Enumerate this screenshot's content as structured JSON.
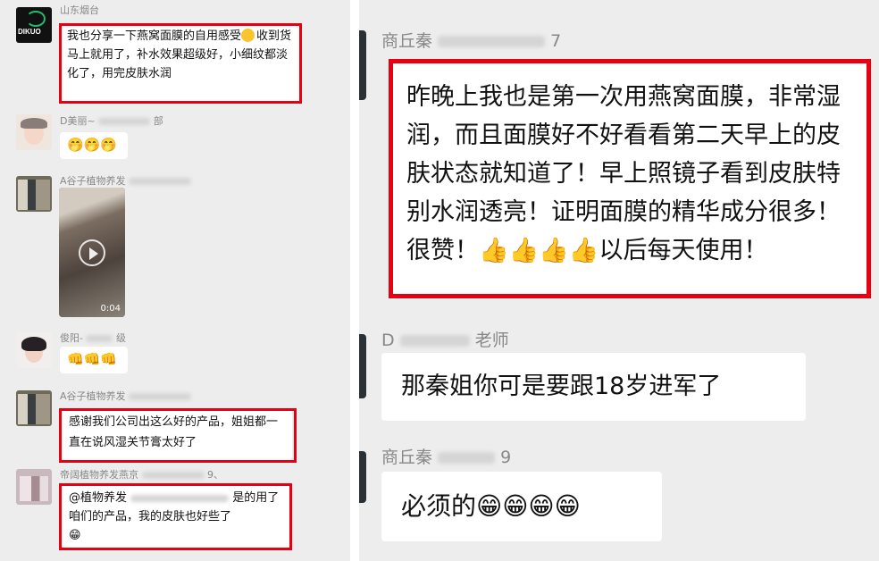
{
  "left_chat": {
    "messages": [
      {
        "sender": "山东烟台",
        "avatar_logo_text": "DIKUO",
        "text_before_emoji": "我也分享一下燕窝面膜的自用感受",
        "text_after_emoji": "收到货马上就用了，补水效果超级好，小细纹都淡化了，用完皮肤水润"
      },
      {
        "sender": "D美丽~",
        "sender_suffix": "部",
        "text": "🤭🤭🤭"
      },
      {
        "sender": "A谷子植物养发",
        "video_duration": "0:04"
      },
      {
        "sender": "俊阳-",
        "sender_suffix": "级",
        "text": "👊👊👊"
      },
      {
        "sender": "A谷子植物养发",
        "text": "感谢我们公司出这么好的产品，姐姐都一直在说风湿关节膏太好了"
      },
      {
        "sender": "帝阔植物养发燕京",
        "sender_suffix": "9、",
        "mention": "@植物养发",
        "text": "是的用了咱们的产品，我的皮肤也好些了",
        "emoji": "😁"
      }
    ]
  },
  "right_chat": {
    "messages": [
      {
        "sender": "商丘秦",
        "sender_suffix": "7",
        "text": "昨晚上我也是第一次用燕窝面膜，非常湿润，而且面膜好不好看看第二天早上的皮肤状态就知道了！早上照镜子看到皮肤特别水润透亮！证明面膜的精华成分很多！很赞！",
        "thumbs": "👍👍👍👍",
        "text_end": "以后每天使用！"
      },
      {
        "sender": "D",
        "sender_suffix": "老师",
        "text": "那秦姐你可是要跟18岁进军了"
      },
      {
        "sender": "商丘秦",
        "sender_suffix": "9",
        "text": "必须的",
        "emoji": "😁😁😁😁"
      }
    ]
  },
  "colors": {
    "chat_background": "#ededed",
    "bubble": "#ffffff",
    "highlight_border": "#e60012",
    "sender_name": "#888888"
  }
}
